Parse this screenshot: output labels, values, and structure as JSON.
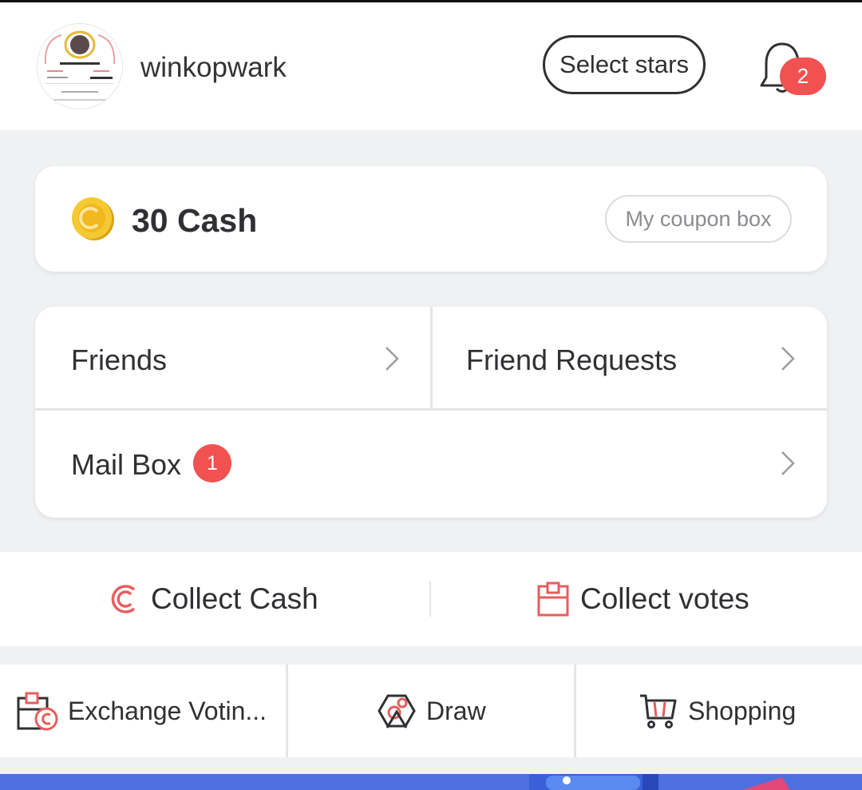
{
  "header": {
    "username": "winkopwark",
    "select_stars_label": "Select stars",
    "notification_count": "2"
  },
  "cash": {
    "amount_label": "30 Cash",
    "coupon_label": "My coupon box"
  },
  "menu": {
    "friends": "Friends",
    "friend_requests": "Friend Requests",
    "mail_box": "Mail Box",
    "mail_count": "1"
  },
  "collect": {
    "cash_label": "Collect Cash",
    "votes_label": "Collect votes"
  },
  "tools": {
    "exchange_label": "Exchange Votin...",
    "draw_label": "Draw",
    "shopping_label": "Shopping"
  },
  "colors": {
    "accent_red": "#f25151",
    "icon_red": "#e85d5d",
    "coin_gold": "#f2c230",
    "banner_blue": "#4d6fe0"
  }
}
